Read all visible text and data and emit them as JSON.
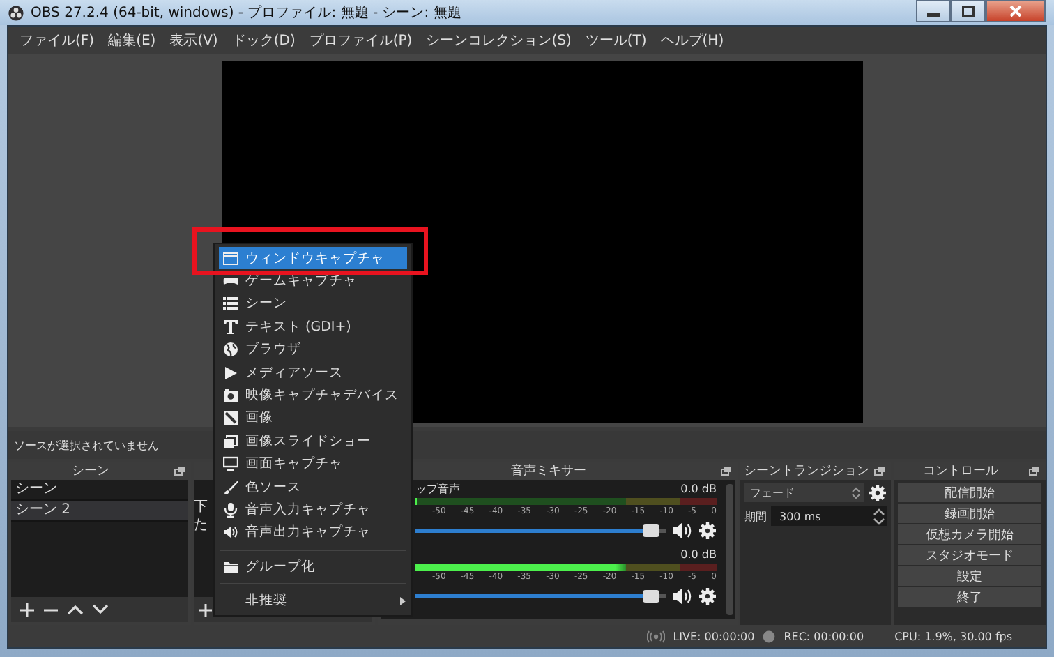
{
  "window": {
    "title": "OBS 27.2.4 (64-bit, windows) - プロファイル: 無題 - シーン: 無題"
  },
  "menu_bar": [
    "ファイル(F)",
    "編集(E)",
    "表示(V)",
    "ドック(D)",
    "プロファイル(P)",
    "シーンコレクション(S)",
    "ツール(T)",
    "ヘルプ(H)"
  ],
  "source_status": "ソースが選択されていません",
  "scenes_dock": {
    "title": "シーン",
    "items": [
      {
        "label": "シーン",
        "selected": false
      },
      {
        "label": "シーン 2",
        "selected": true
      }
    ]
  },
  "sources_dock": {
    "hint_fragments": [
      "下",
      "た"
    ]
  },
  "mixer": {
    "title": "音声ミキサー",
    "channels": [
      {
        "name": "ップ音声",
        "reading": "0.0 dB",
        "meter": {
          "level": 0
        },
        "ticks": [
          "-50",
          "-45",
          "-40",
          "-35",
          "-30",
          "-25",
          "-20",
          "-15",
          "-10",
          "-5",
          "0"
        ],
        "volume": {
          "level": 0.97
        }
      },
      {
        "reading": "0.0 dB",
        "meter": {
          "level": 0.7
        },
        "ticks": [
          "-50",
          "-45",
          "-40",
          "-35",
          "-30",
          "-25",
          "-20",
          "-15",
          "-10",
          "-5",
          "0"
        ],
        "volume": {
          "level": 0.97
        }
      }
    ]
  },
  "transitions": {
    "title": "シーントランジション",
    "transition": "フェード",
    "duration_label": "期間",
    "duration": "300 ms"
  },
  "controls": {
    "title": "コントロール",
    "buttons": [
      "配信開始",
      "録画開始",
      "仮想カメラ開始",
      "スタジオモード",
      "設定",
      "終了"
    ]
  },
  "status_bar": {
    "live": "LIVE: 00:00:00",
    "rec": "REC: 00:00:00",
    "cpu": "CPU: 1.9%, 30.00 fps"
  },
  "context_menu": {
    "items": [
      {
        "kind": "item",
        "label": "ウィンドウキャプチャ",
        "selected": true
      },
      {
        "kind": "item",
        "label": "ゲームキャプチャ",
        "selected": false
      },
      {
        "kind": "item",
        "label": "シーン",
        "selected": false
      },
      {
        "kind": "item",
        "label": "テキスト (GDI+)",
        "selected": false
      },
      {
        "kind": "item",
        "label": "ブラウザ",
        "selected": false
      },
      {
        "kind": "item",
        "label": "メディアソース",
        "selected": false
      },
      {
        "kind": "item",
        "label": "映像キャプチャデバイス",
        "selected": false
      },
      {
        "kind": "item",
        "label": "画像",
        "selected": false
      },
      {
        "kind": "item",
        "label": "画像スライドショー",
        "selected": false
      },
      {
        "kind": "item",
        "label": "画面キャプチャ",
        "selected": false
      },
      {
        "kind": "item",
        "label": "色ソース",
        "selected": false
      },
      {
        "kind": "item",
        "label": "音声入力キャプチャ",
        "selected": false
      },
      {
        "kind": "item",
        "label": "音声出力キャプチャ",
        "selected": false
      },
      {
        "kind": "separator"
      },
      {
        "kind": "item",
        "label": "グループ化",
        "selected": false
      },
      {
        "kind": "separator"
      },
      {
        "kind": "submenu",
        "label": "非推奨",
        "selected": false
      }
    ]
  }
}
